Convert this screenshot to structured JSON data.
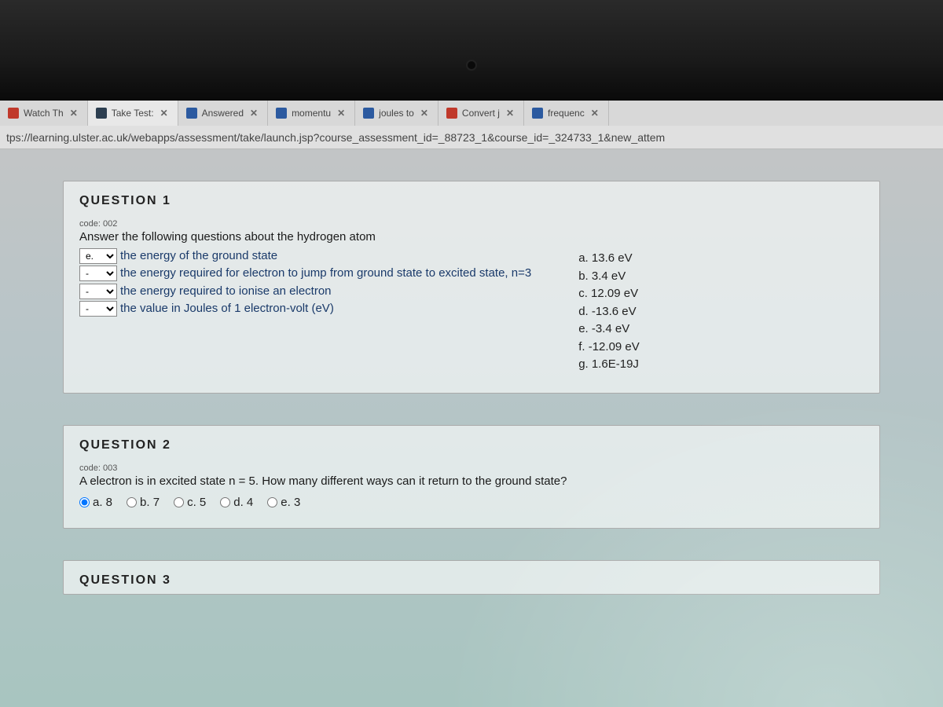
{
  "tabs": [
    {
      "label": "Watch Th",
      "favicon": "red"
    },
    {
      "label": "Take Test:",
      "favicon": "bb",
      "active": true
    },
    {
      "label": "Answered",
      "favicon": "blue"
    },
    {
      "label": "momentu",
      "favicon": "blue"
    },
    {
      "label": "joules to",
      "favicon": "blue"
    },
    {
      "label": "Convert j",
      "favicon": "red"
    },
    {
      "label": "frequenc",
      "favicon": "blue"
    }
  ],
  "close_glyph": "✕",
  "url": "tps://learning.ulster.ac.uk/webapps/assessment/take/launch.jsp?course_assessment_id=_88723_1&course_id=_324733_1&new_attem",
  "q1": {
    "title": "QUESTION 1",
    "code": "code: 002",
    "prompt": "Answer the following questions about the hydrogen atom",
    "items": [
      {
        "sel": "e.",
        "text": "the energy of the ground state"
      },
      {
        "sel": "-",
        "text": "the energy required for electron to jump from ground state to excited state, n=3"
      },
      {
        "sel": "-",
        "text": "the energy required to ionise an electron"
      },
      {
        "sel": "-",
        "text": "the value in Joules of 1 electron-volt (eV)"
      }
    ],
    "answers": [
      "a. 13.6 eV",
      "b. 3.4 eV",
      "c. 12.09 eV",
      "d. -13.6 eV",
      "e. -3.4 eV",
      "f. -12.09 eV",
      "g. 1.6E-19J"
    ]
  },
  "q2": {
    "title": "QUESTION 2",
    "code": "code: 003",
    "prompt": "A electron is in excited state n = 5. How many different ways can it return to the ground state?",
    "options": [
      {
        "label": "a. 8",
        "checked": true
      },
      {
        "label": "b. 7",
        "checked": false
      },
      {
        "label": "c. 5",
        "checked": false
      },
      {
        "label": "d. 4",
        "checked": false
      },
      {
        "label": "e. 3",
        "checked": false
      }
    ]
  },
  "q3": {
    "title": "QUESTION 3"
  }
}
